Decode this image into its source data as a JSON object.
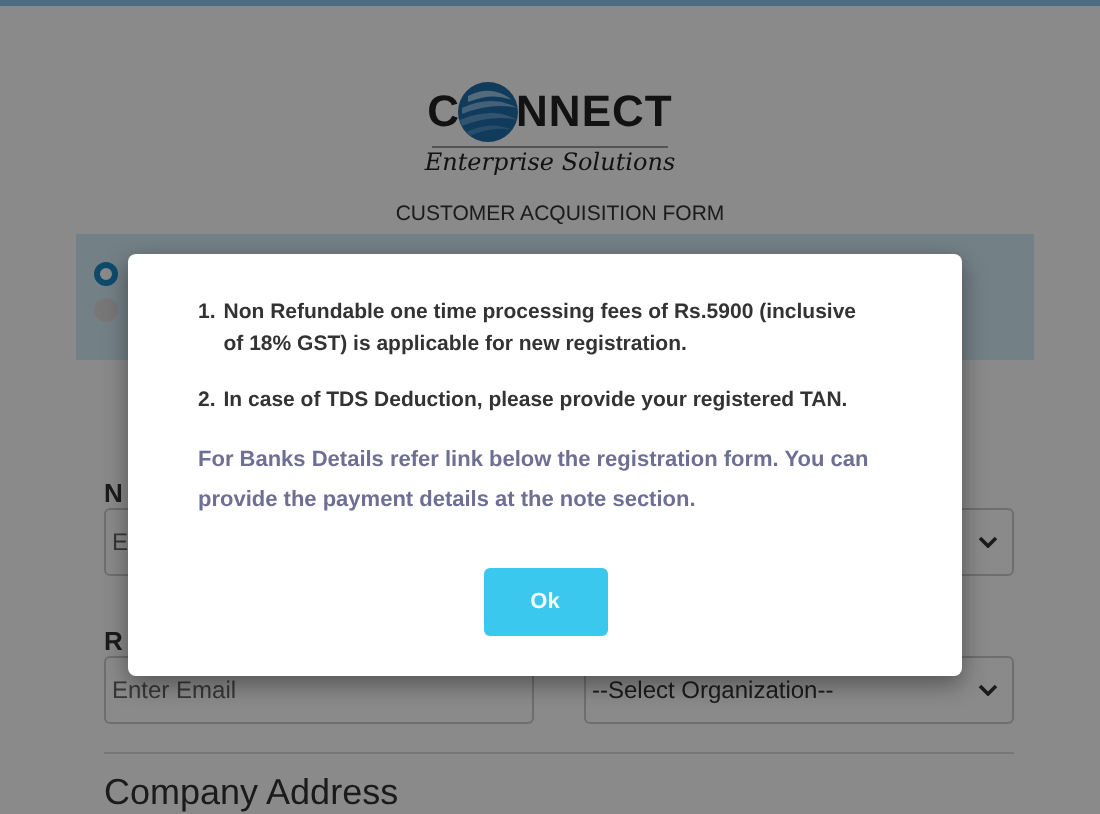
{
  "logo": {
    "letter": "C",
    "wordmark": "NNECT",
    "tagline": "Enterprise Solutions"
  },
  "form_title": "CUSTOMER ACQUISITION FORM",
  "options": [
    {
      "selected": true
    },
    {
      "selected": false
    }
  ],
  "fields": [
    {
      "kind": "input",
      "label": "N",
      "placeholder": "E"
    },
    {
      "kind": "select"
    },
    {
      "kind": "input",
      "label": "R",
      "placeholder": "Enter Email"
    },
    {
      "kind": "select",
      "value": "--Select Organization--"
    }
  ],
  "section_heading": "Company Address",
  "modal": {
    "items": [
      {
        "number": "1.",
        "text": "Non Refundable one time processing fees of Rs.5900 (inclusive of 18% GST) is applicable for new registration."
      },
      {
        "number": "2.",
        "text": "In case of TDS Deduction, please provide your registered TAN."
      }
    ],
    "note": "For Banks Details refer link below the registration form. You can provide the payment details at the note section.",
    "button": "Ok"
  }
}
